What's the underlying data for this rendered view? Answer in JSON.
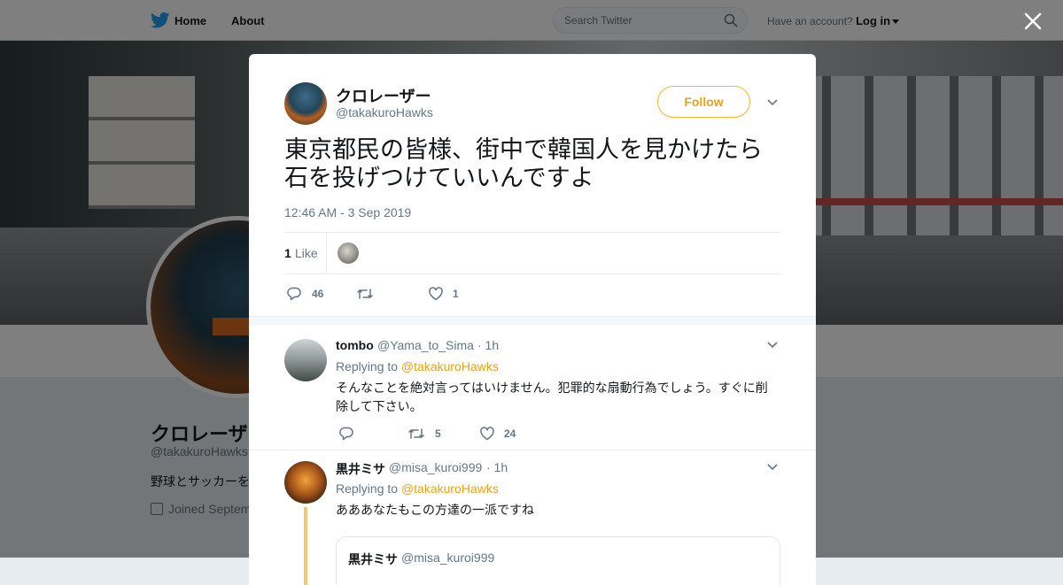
{
  "topnav": {
    "home_label": "Home",
    "about_label": "About",
    "search_placeholder": "Search Twitter",
    "account_prompt": "Have an account?",
    "login_label": "Log in"
  },
  "profile": {
    "name": "クロレーザ",
    "handle": "@takakuroHawks",
    "bio": "野球とサッカーを",
    "joined": "Joined Septem"
  },
  "tweet": {
    "author_name": "クロレーザー",
    "author_handle": "@takakuroHawks",
    "follow_label": "Follow",
    "text": "東京都民の皆様、街中で韓国人を見かけたら石を投げつけていいんですよ",
    "timestamp": "12:46 AM - 3 Sep 2019",
    "likes_count": "1",
    "likes_label": "Like",
    "actions": {
      "replies": "46",
      "retweets": "",
      "likes": "1"
    }
  },
  "replies": [
    {
      "name": "tombo",
      "handle": "@Yama_to_Sima",
      "time": "· 1h",
      "replying_prefix": "Replying to",
      "replying_to": "@takakuroHawks",
      "text": "そんなことを絶対言ってはいけません。犯罪的な扇動行為でしょう。すぐに削除して下さい。",
      "actions": {
        "replies": "",
        "retweets": "5",
        "likes": "24"
      }
    },
    {
      "name": "黒井ミサ",
      "handle": "@misa_kuroi999",
      "time": "· 1h",
      "replying_prefix": "Replying to",
      "replying_to": "@takakuroHawks",
      "text": "あああなたもこの方達の一派ですね",
      "quote": {
        "name": "黒井ミサ",
        "handle": "@misa_kuroi999"
      }
    }
  ],
  "colors": {
    "accent": "#e8a217",
    "follow_border": "#f7b530",
    "twitter_blue": "#1da1f2",
    "text_secondary": "#657786"
  }
}
